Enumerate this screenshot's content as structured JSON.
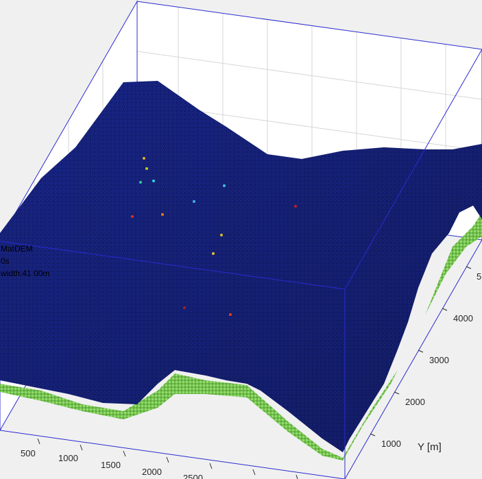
{
  "figure": {
    "overlay": {
      "line1": "MatDEM",
      "line2": "0s",
      "line3": "width:41 00m"
    },
    "axes": {
      "x_ticks": [
        "500",
        "1000",
        "1500",
        "2000",
        "2500"
      ],
      "y_ticks": [
        "1000",
        "2000",
        "3000",
        "4000",
        "5"
      ],
      "y_label": "Y [m]"
    },
    "colors": {
      "background": "#f0f0f0",
      "box_edge": "#2a2ad0",
      "grid": "#d6d6d6",
      "surface": "#14207a",
      "base_layer": "#7ed05a"
    },
    "markers": [
      {
        "color": "#e0b020"
      },
      {
        "color": "#c8c820"
      },
      {
        "color": "#30c8a0"
      },
      {
        "color": "#30d0e0"
      },
      {
        "color": "#40b0e0"
      },
      {
        "color": "#e03020"
      },
      {
        "color": "#e08020"
      },
      {
        "color": "#d0c030"
      },
      {
        "color": "#e0c030"
      },
      {
        "color": "#40c0e0"
      },
      {
        "color": "#c02020"
      },
      {
        "color": "#a02020"
      },
      {
        "color": "#e04020"
      }
    ]
  }
}
